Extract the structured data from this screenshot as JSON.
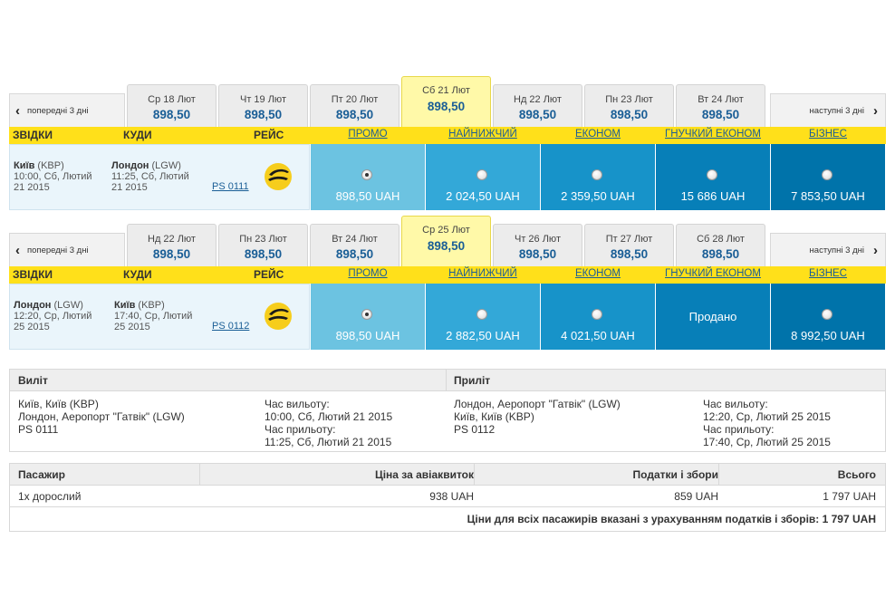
{
  "outbound": {
    "prev_label": "попередні 3 дні",
    "next_label": "наступні 3 дні",
    "dates": [
      {
        "label": "Ср 18 Лют",
        "price": "898,50"
      },
      {
        "label": "Чт 19 Лют",
        "price": "898,50"
      },
      {
        "label": "Пт 20 Лют",
        "price": "898,50"
      },
      {
        "label": "Сб 21 Лют",
        "price": "898,50",
        "selected": true
      },
      {
        "label": "Нд 22 Лют",
        "price": "898,50"
      },
      {
        "label": "Пн 23 Лют",
        "price": "898,50"
      },
      {
        "label": "Вт 24 Лют",
        "price": "898,50"
      }
    ],
    "headers": {
      "from": "ЗВІДКИ",
      "to": "КУДИ",
      "flight": "РЕЙС"
    },
    "fares": [
      "ПРОМО",
      "НАЙНИЖЧИЙ",
      "ЕКОНОМ",
      "ГНУЧКИЙ ЕКОНОМ",
      "БІЗНЕС"
    ],
    "from_city": "Київ",
    "from_code": "(KBP)",
    "from_time": "10:00, Сб, Лютий",
    "from_date": "21 2015",
    "to_city": "Лондон",
    "to_code": "(LGW)",
    "to_time": "11:25, Сб, Лютий",
    "to_date": "21 2015",
    "flight_no": "PS 0111",
    "prices": [
      "898,50 UAH",
      "2 024,50 UAH",
      "2 359,50 UAH",
      "15 686 UAH",
      "7 853,50 UAH"
    ]
  },
  "return": {
    "prev_label": "попередні 3 дні",
    "next_label": "наступні 3 дні",
    "dates": [
      {
        "label": "Нд 22 Лют",
        "price": "898,50"
      },
      {
        "label": "Пн 23 Лют",
        "price": "898,50"
      },
      {
        "label": "Вт 24 Лют",
        "price": "898,50"
      },
      {
        "label": "Ср 25 Лют",
        "price": "898,50",
        "selected": true
      },
      {
        "label": "Чт 26 Лют",
        "price": "898,50"
      },
      {
        "label": "Пт 27 Лют",
        "price": "898,50"
      },
      {
        "label": "Сб 28 Лют",
        "price": "898,50"
      }
    ],
    "headers": {
      "from": "ЗВІДКИ",
      "to": "КУДИ",
      "flight": "РЕЙС"
    },
    "fares": [
      "ПРОМО",
      "НАЙНИЖЧИЙ",
      "ЕКОНОМ",
      "ГНУЧКИЙ ЕКОНОМ",
      "БІЗНЕС"
    ],
    "from_city": "Лондон",
    "from_code": "(LGW)",
    "from_time": "12:20, Ср, Лютий",
    "from_date": "25 2015",
    "to_city": "Київ",
    "to_code": "(KBP)",
    "to_time": "17:40, Ср, Лютий",
    "to_date": "25 2015",
    "flight_no": "PS 0112",
    "prices": [
      "898,50 UAH",
      "2 882,50 UAH",
      "4 021,50 UAH",
      "Продано",
      "8 992,50 UAH"
    ]
  },
  "summary": {
    "departure_title": "Виліт",
    "arrival_title": "Приліт",
    "dep_route_1": "Київ, Київ (KBP)",
    "dep_route_2": "Лондон, Аеропорт \"Гатвік\" (LGW)",
    "dep_flight": "PS 0111",
    "dep_depart_label": "Час вильоту:",
    "dep_depart_value": "10:00, Сб, Лютий 21 2015",
    "dep_arrive_label": "Час прильоту:",
    "dep_arrive_value": "11:25, Сб, Лютий 21 2015",
    "arr_route_1": "Лондон, Аеропорт \"Гатвік\" (LGW)",
    "arr_route_2": "Київ, Київ (KBP)",
    "arr_flight": "PS 0112",
    "arr_depart_label": "Час вильоту:",
    "arr_depart_value": "12:20, Ср, Лютий 25 2015",
    "arr_arrive_label": "Час прильоту:",
    "arr_arrive_value": "17:40, Ср, Лютий 25 2015"
  },
  "price_table": {
    "headers": [
      "Пасажир",
      "Ціна за авіаквиток",
      "Податки і збори",
      "Всього"
    ],
    "row": [
      "1х дорослий",
      "938 UAH",
      "859 UAH",
      "1 797 UAH"
    ],
    "total_note": "Ціни для всіх пасажирів вказані з урахуванням податків і зборів: 1 797 UAH"
  },
  "colors": {
    "header_yellow": "#ffe01a",
    "selected_tab": "#fff9a8",
    "fare_promo": "#6cc3e1",
    "fare_lowest": "#33a8d8",
    "fare_economy": "#1793c9",
    "fare_flex": "#077fb8",
    "fare_business": "#0073aa",
    "price_blue": "#1a5e96"
  },
  "icons": {
    "prev": "chevron-left-icon",
    "next": "chevron-right-icon",
    "airline": "airline-logo-icon",
    "radio": "radio-button"
  }
}
